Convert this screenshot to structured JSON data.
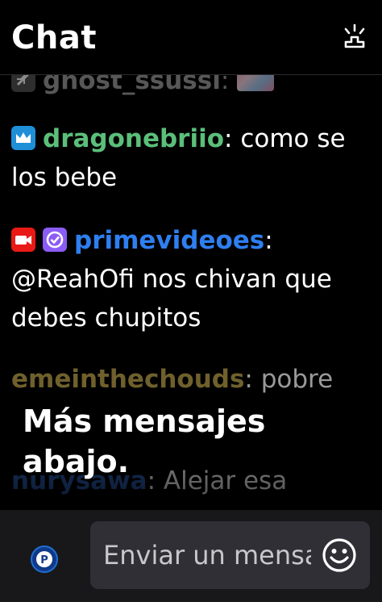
{
  "header": {
    "title": "Chat"
  },
  "messages": [
    {
      "user": "ghost_ssussi",
      "text": "",
      "user_color": "#9e9e9e"
    },
    {
      "user": "dragonebriio",
      "text": "como se los bebe",
      "user_color": "#5bbf7a"
    },
    {
      "user": "primevideoes",
      "text": "@ReahOfi nos chivan que debes chupitos",
      "user_color": "#2e7ff0"
    },
    {
      "user": "emeinthechouds",
      "text": "pobre",
      "user_color": "#b9a14a"
    },
    {
      "user": "nurysawa",
      "text": "Alejar esa",
      "user_color": "#2a5aa8"
    }
  ],
  "more_messages": "Más mensajes abajo.",
  "composer": {
    "placeholder": "Enviar un mensaje"
  },
  "icons": {
    "header": "live-activity-icon",
    "emoji": "smiley-icon",
    "avatar": "user-avatar"
  }
}
